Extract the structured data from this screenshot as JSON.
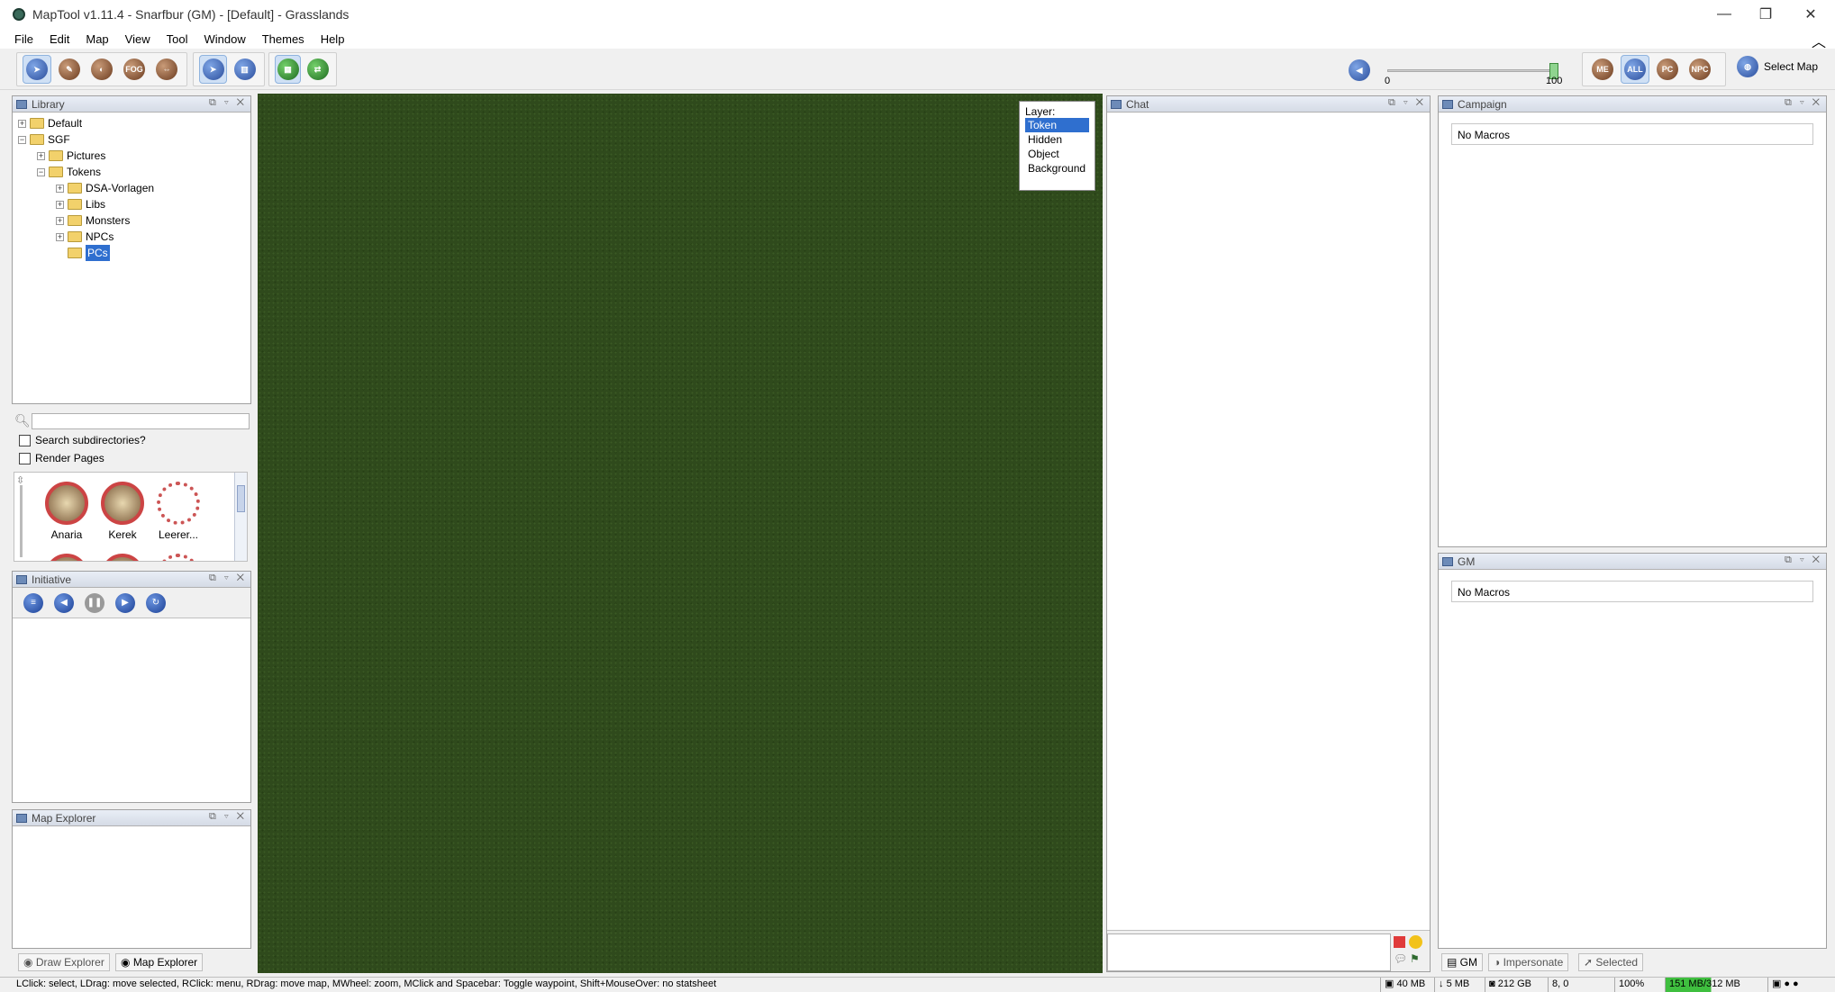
{
  "window": {
    "title": "MapTool v1.11.4 - Snarfbur (GM) - [Default] - Grasslands",
    "minimize": "—",
    "maximize": "❐",
    "close": "✕"
  },
  "menu": [
    "File",
    "Edit",
    "Map",
    "View",
    "Tool",
    "Window",
    "Themes",
    "Help"
  ],
  "toolbar": {
    "slider_min": "0",
    "slider_max": "100",
    "slider_value": 100,
    "visibility_buttons": [
      "ME",
      "ALL",
      "PC",
      "NPC"
    ],
    "select_map_label": "Select Map",
    "fog_label": "FOG"
  },
  "library": {
    "title": "Library",
    "tree": [
      {
        "label": "Default",
        "depth": 0,
        "expander": "+"
      },
      {
        "label": "SGF",
        "depth": 0,
        "expander": "−"
      },
      {
        "label": "Pictures",
        "depth": 1,
        "expander": "+"
      },
      {
        "label": "Tokens",
        "depth": 1,
        "expander": "−"
      },
      {
        "label": "DSA-Vorlagen",
        "depth": 2,
        "expander": "+"
      },
      {
        "label": "Libs",
        "depth": 2,
        "expander": "+"
      },
      {
        "label": "Monsters",
        "depth": 2,
        "expander": "+"
      },
      {
        "label": "NPCs",
        "depth": 2,
        "expander": "+"
      },
      {
        "label": "PCs",
        "depth": 2,
        "expander": "",
        "selected": true
      }
    ],
    "search_placeholder": "",
    "search_subdirs_label": "Search subdirectories?",
    "render_pages_label": "Render Pages",
    "tokens": [
      "Anaria",
      "Kerek",
      "Leerer..."
    ]
  },
  "initiative": {
    "title": "Initiative"
  },
  "map_explorer": {
    "title": "Map Explorer"
  },
  "bottom_tabs": {
    "draw_explorer": "Draw Explorer",
    "map_explorer": "Map Explorer"
  },
  "layers": {
    "heading": "Layer:",
    "options": [
      "Token",
      "Hidden",
      "Object",
      "Background"
    ],
    "selected": "Token"
  },
  "chat": {
    "title": "Chat"
  },
  "campaign": {
    "title": "Campaign",
    "empty": "No Macros"
  },
  "gm": {
    "title": "GM",
    "empty": "No Macros"
  },
  "right_tabs": {
    "gm": "GM",
    "impersonate": "Impersonate",
    "selected": "Selected"
  },
  "status": {
    "hint": "LClick: select, LDrag: move selected, RClick: menu, RDrag: move map, MWheel: zoom, MClick and Spacebar: Toggle waypoint, Shift+MouseOver: no statsheet",
    "cache": "40 MB",
    "assets": "5 MB",
    "disk": "212 GB",
    "coords": "8, 0",
    "zoom": "100%",
    "memory": "151 MB/312 MB"
  },
  "colors": {
    "map_grass": "#2f4a1c",
    "selection": "#2f6fcf",
    "panel_header": "#dbe2ee"
  }
}
